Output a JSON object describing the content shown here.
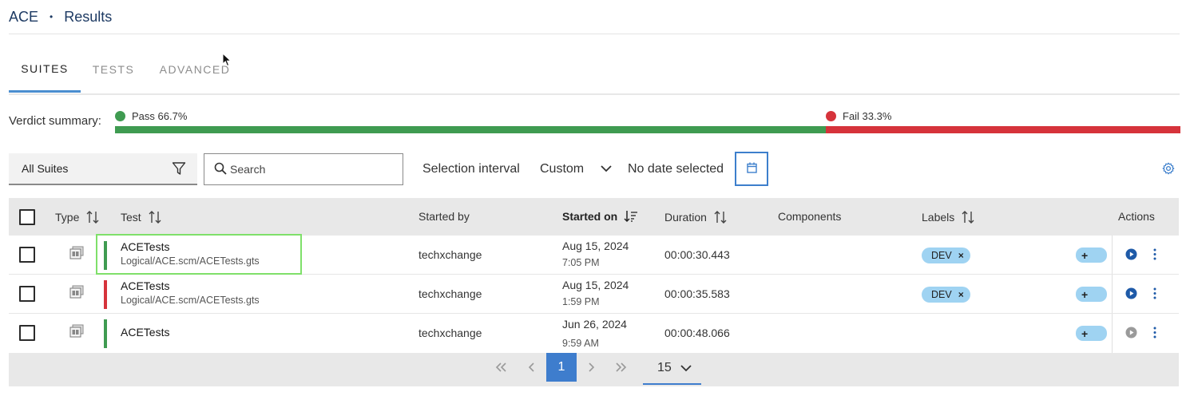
{
  "breadcrumb": {
    "root": "ACE",
    "separator": "•",
    "current": "Results"
  },
  "tabs": [
    {
      "label": "SUITES",
      "active": true
    },
    {
      "label": "TESTS",
      "active": false
    },
    {
      "label": "ADVANCED",
      "active": false
    }
  ],
  "verdict": {
    "label": "Verdict summary:",
    "pass": {
      "label": "Pass 66.7%",
      "fraction": 0.667,
      "color": "#3f9b51"
    },
    "fail": {
      "label": "Fail 33.3%",
      "fraction": 0.333,
      "color": "#d6333b"
    }
  },
  "toolbar": {
    "suite_filter": "All Suites",
    "search_placeholder": "Search",
    "selection_interval_label": "Selection interval",
    "selection_interval_value": "Custom",
    "date_label": "No date selected"
  },
  "table": {
    "columns": {
      "type": "Type",
      "test": "Test",
      "started_by": "Started by",
      "started_on": "Started on",
      "duration": "Duration",
      "components": "Components",
      "labels": "Labels",
      "actions": "Actions"
    },
    "rows": [
      {
        "name": "ACETests",
        "path": "Logical/ACE.scm/ACETests.gts",
        "verdict": "pass",
        "started_by": "techxchange",
        "date": "Aug 15, 2024",
        "time": "7:05 PM",
        "duration": "00:00:30.443",
        "label": "DEV",
        "add": "+",
        "run_enabled": true
      },
      {
        "name": "ACETests",
        "path": "Logical/ACE.scm/ACETests.gts",
        "verdict": "fail",
        "started_by": "techxchange",
        "date": "Aug 15, 2024",
        "time": "1:59 PM",
        "duration": "00:00:35.583",
        "label": "DEV",
        "add": "+",
        "run_enabled": true
      },
      {
        "name": "ACETests",
        "path": "",
        "verdict": "pass",
        "started_by": "techxchange",
        "date": "Jun 26, 2024",
        "time": "9:59 AM",
        "duration": "00:00:48.066",
        "label": "",
        "add": "+",
        "run_enabled": false
      }
    ]
  },
  "pagination": {
    "current_page": "1",
    "per_page": "15"
  },
  "icons": [
    "filter-icon",
    "search-icon",
    "chevron-down-icon",
    "calendar-icon",
    "gear-icon",
    "sort-icon",
    "suite-type-icon",
    "play-icon",
    "kebab-icon",
    "first-page-icon",
    "prev-page-icon",
    "next-page-icon",
    "last-page-icon"
  ],
  "colors": {
    "accent": "#3e7dcd",
    "pass": "#3f9b51",
    "fail": "#d6333b",
    "label_bg": "#9fd3f2",
    "highlight": "#7fe06a"
  }
}
